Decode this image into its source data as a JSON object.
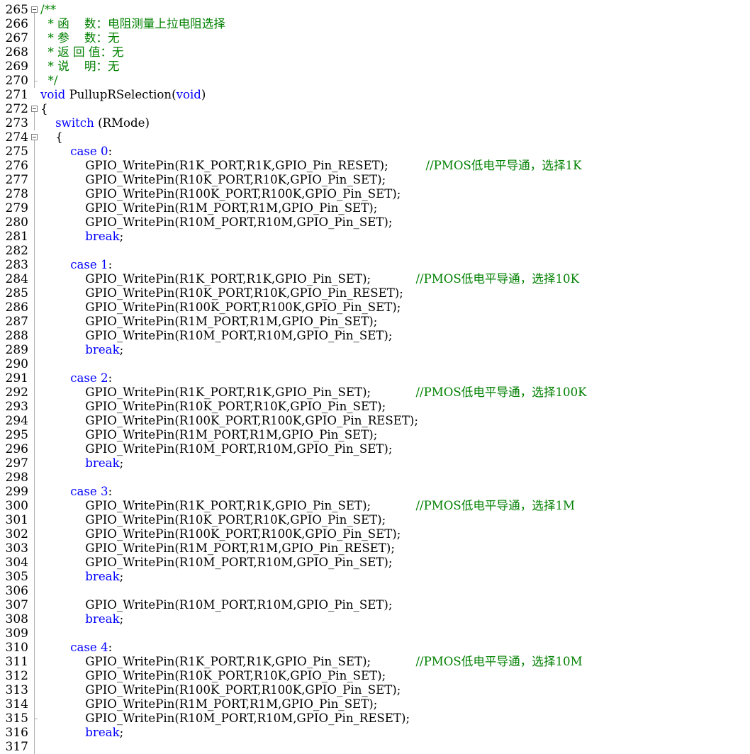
{
  "editor": {
    "colors": {
      "background": "#ffffff",
      "keyword": "#0000ff",
      "comment": "#008000",
      "text": "#000000",
      "line_number": "#000000",
      "fold_marker": "#808080"
    },
    "lines": [
      {
        "num": "265",
        "fold": "minus",
        "tokens": [
          {
            "t": "/**",
            "k": "cm"
          }
        ]
      },
      {
        "num": "266",
        "fold": "line",
        "tokens": [
          {
            "t": "  * 函    数：电阻测量上拉电阻选择",
            "k": "cm"
          }
        ]
      },
      {
        "num": "267",
        "fold": "line",
        "tokens": [
          {
            "t": "  * 参    数：无",
            "k": "cm"
          }
        ]
      },
      {
        "num": "268",
        "fold": "line",
        "tokens": [
          {
            "t": "  * 返 回 值：无",
            "k": "cm"
          }
        ]
      },
      {
        "num": "269",
        "fold": "line",
        "tokens": [
          {
            "t": "  * 说    明：无",
            "k": "cm"
          }
        ]
      },
      {
        "num": "270",
        "fold": "end",
        "tokens": [
          {
            "t": "  */",
            "k": "cm"
          }
        ]
      },
      {
        "num": "271",
        "fold": "",
        "tokens": [
          {
            "t": "void",
            "k": "kw"
          },
          {
            "t": " PullupRSelection(",
            "k": "tx"
          },
          {
            "t": "void",
            "k": "kw"
          },
          {
            "t": ")",
            "k": "tx"
          }
        ]
      },
      {
        "num": "272",
        "fold": "minus",
        "tokens": [
          {
            "t": "{",
            "k": "tx"
          }
        ]
      },
      {
        "num": "273",
        "fold": "line",
        "tokens": [
          {
            "t": "    ",
            "k": "tx"
          },
          {
            "t": "switch",
            "k": "kw"
          },
          {
            "t": " (RMode)",
            "k": "tx"
          }
        ]
      },
      {
        "num": "274",
        "fold": "minus",
        "tokens": [
          {
            "t": "    {",
            "k": "tx"
          }
        ]
      },
      {
        "num": "275",
        "fold": "line",
        "tokens": [
          {
            "t": "        ",
            "k": "tx"
          },
          {
            "t": "case",
            "k": "kw"
          },
          {
            "t": " ",
            "k": "tx"
          },
          {
            "t": "0",
            "k": "kw"
          },
          {
            "t": ":",
            "k": "tx"
          }
        ]
      },
      {
        "num": "276",
        "fold": "line",
        "tokens": [
          {
            "t": "            GPIO_WritePin(R1K_PORT,R1K,GPIO_Pin_RESET);          ",
            "k": "tx"
          },
          {
            "t": "//PMOS低电平导通，选择1K",
            "k": "cm"
          }
        ]
      },
      {
        "num": "277",
        "fold": "line",
        "tokens": [
          {
            "t": "            GPIO_WritePin(R10K_PORT,R10K,GPIO_Pin_SET);",
            "k": "tx"
          }
        ]
      },
      {
        "num": "278",
        "fold": "line",
        "tokens": [
          {
            "t": "            GPIO_WritePin(R100K_PORT,R100K,GPIO_Pin_SET);",
            "k": "tx"
          }
        ]
      },
      {
        "num": "279",
        "fold": "line",
        "tokens": [
          {
            "t": "            GPIO_WritePin(R1M_PORT,R1M,GPIO_Pin_SET);",
            "k": "tx"
          }
        ]
      },
      {
        "num": "280",
        "fold": "line",
        "tokens": [
          {
            "t": "            GPIO_WritePin(R10M_PORT,R10M,GPIO_Pin_SET);",
            "k": "tx"
          }
        ]
      },
      {
        "num": "281",
        "fold": "line",
        "tokens": [
          {
            "t": "            ",
            "k": "tx"
          },
          {
            "t": "break",
            "k": "kw"
          },
          {
            "t": ";",
            "k": "tx"
          }
        ]
      },
      {
        "num": "282",
        "fold": "line",
        "tokens": []
      },
      {
        "num": "283",
        "fold": "line",
        "tokens": [
          {
            "t": "        ",
            "k": "tx"
          },
          {
            "t": "case",
            "k": "kw"
          },
          {
            "t": " ",
            "k": "tx"
          },
          {
            "t": "1",
            "k": "kw"
          },
          {
            "t": ":",
            "k": "tx"
          }
        ]
      },
      {
        "num": "284",
        "fold": "line",
        "tokens": [
          {
            "t": "            GPIO_WritePin(R1K_PORT,R1K,GPIO_Pin_SET);            ",
            "k": "tx"
          },
          {
            "t": "//PMOS低电平导通，选择10K",
            "k": "cm"
          }
        ]
      },
      {
        "num": "285",
        "fold": "line",
        "tokens": [
          {
            "t": "            GPIO_WritePin(R10K_PORT,R10K,GPIO_Pin_RESET);",
            "k": "tx"
          }
        ]
      },
      {
        "num": "286",
        "fold": "line",
        "tokens": [
          {
            "t": "            GPIO_WritePin(R100K_PORT,R100K,GPIO_Pin_SET);",
            "k": "tx"
          }
        ]
      },
      {
        "num": "287",
        "fold": "line",
        "tokens": [
          {
            "t": "            GPIO_WritePin(R1M_PORT,R1M,GPIO_Pin_SET);",
            "k": "tx"
          }
        ]
      },
      {
        "num": "288",
        "fold": "line",
        "tokens": [
          {
            "t": "            GPIO_WritePin(R10M_PORT,R10M,GPIO_Pin_SET);",
            "k": "tx"
          }
        ]
      },
      {
        "num": "289",
        "fold": "line",
        "tokens": [
          {
            "t": "            ",
            "k": "tx"
          },
          {
            "t": "break",
            "k": "kw"
          },
          {
            "t": ";",
            "k": "tx"
          }
        ]
      },
      {
        "num": "290",
        "fold": "line",
        "tokens": []
      },
      {
        "num": "291",
        "fold": "line",
        "tokens": [
          {
            "t": "        ",
            "k": "tx"
          },
          {
            "t": "case",
            "k": "kw"
          },
          {
            "t": " ",
            "k": "tx"
          },
          {
            "t": "2",
            "k": "kw"
          },
          {
            "t": ":",
            "k": "tx"
          }
        ]
      },
      {
        "num": "292",
        "fold": "line",
        "tokens": [
          {
            "t": "            GPIO_WritePin(R1K_PORT,R1K,GPIO_Pin_SET);            ",
            "k": "tx"
          },
          {
            "t": "//PMOS低电平导通，选择100K",
            "k": "cm"
          }
        ]
      },
      {
        "num": "293",
        "fold": "line",
        "tokens": [
          {
            "t": "            GPIO_WritePin(R10K_PORT,R10K,GPIO_Pin_SET);",
            "k": "tx"
          }
        ]
      },
      {
        "num": "294",
        "fold": "line",
        "tokens": [
          {
            "t": "            GPIO_WritePin(R100K_PORT,R100K,GPIO_Pin_RESET);",
            "k": "tx"
          }
        ]
      },
      {
        "num": "295",
        "fold": "line",
        "tokens": [
          {
            "t": "            GPIO_WritePin(R1M_PORT,R1M,GPIO_Pin_SET);",
            "k": "tx"
          }
        ]
      },
      {
        "num": "296",
        "fold": "line",
        "tokens": [
          {
            "t": "            GPIO_WritePin(R10M_PORT,R10M,GPIO_Pin_SET);",
            "k": "tx"
          }
        ]
      },
      {
        "num": "297",
        "fold": "line",
        "tokens": [
          {
            "t": "            ",
            "k": "tx"
          },
          {
            "t": "break",
            "k": "kw"
          },
          {
            "t": ";",
            "k": "tx"
          }
        ]
      },
      {
        "num": "298",
        "fold": "line",
        "tokens": []
      },
      {
        "num": "299",
        "fold": "line",
        "tokens": [
          {
            "t": "        ",
            "k": "tx"
          },
          {
            "t": "case",
            "k": "kw"
          },
          {
            "t": " ",
            "k": "tx"
          },
          {
            "t": "3",
            "k": "kw"
          },
          {
            "t": ":",
            "k": "tx"
          }
        ]
      },
      {
        "num": "300",
        "fold": "line",
        "tokens": [
          {
            "t": "            GPIO_WritePin(R1K_PORT,R1K,GPIO_Pin_SET);            ",
            "k": "tx"
          },
          {
            "t": "//PMOS低电平导通，选择1M",
            "k": "cm"
          }
        ]
      },
      {
        "num": "301",
        "fold": "line",
        "tokens": [
          {
            "t": "            GPIO_WritePin(R10K_PORT,R10K,GPIO_Pin_SET);",
            "k": "tx"
          }
        ]
      },
      {
        "num": "302",
        "fold": "line",
        "tokens": [
          {
            "t": "            GPIO_WritePin(R100K_PORT,R100K,GPIO_Pin_SET);",
            "k": "tx"
          }
        ]
      },
      {
        "num": "303",
        "fold": "line",
        "tokens": [
          {
            "t": "            GPIO_WritePin(R1M_PORT,R1M,GPIO_Pin_RESET);",
            "k": "tx"
          }
        ]
      },
      {
        "num": "304",
        "fold": "line",
        "tokens": [
          {
            "t": "            GPIO_WritePin(R10M_PORT,R10M,GPIO_Pin_SET);",
            "k": "tx"
          }
        ]
      },
      {
        "num": "305",
        "fold": "line",
        "tokens": [
          {
            "t": "            ",
            "k": "tx"
          },
          {
            "t": "break",
            "k": "kw"
          },
          {
            "t": ";",
            "k": "tx"
          }
        ]
      },
      {
        "num": "306",
        "fold": "line",
        "tokens": []
      },
      {
        "num": "307",
        "fold": "line",
        "tokens": [
          {
            "t": "            GPIO_WritePin(R10M_PORT,R10M,GPIO_Pin_SET);",
            "k": "tx"
          }
        ]
      },
      {
        "num": "308",
        "fold": "line",
        "tokens": [
          {
            "t": "            ",
            "k": "tx"
          },
          {
            "t": "break",
            "k": "kw"
          },
          {
            "t": ";",
            "k": "tx"
          }
        ]
      },
      {
        "num": "309",
        "fold": "line",
        "tokens": []
      },
      {
        "num": "310",
        "fold": "line",
        "tokens": [
          {
            "t": "        ",
            "k": "tx"
          },
          {
            "t": "case",
            "k": "kw"
          },
          {
            "t": " ",
            "k": "tx"
          },
          {
            "t": "4",
            "k": "kw"
          },
          {
            "t": ":",
            "k": "tx"
          }
        ]
      },
      {
        "num": "311",
        "fold": "line",
        "tokens": [
          {
            "t": "            GPIO_WritePin(R1K_PORT,R1K,GPIO_Pin_SET);            ",
            "k": "tx"
          },
          {
            "t": "//PMOS低电平导通，选择10M",
            "k": "cm"
          }
        ]
      },
      {
        "num": "312",
        "fold": "line",
        "tokens": [
          {
            "t": "            GPIO_WritePin(R10K_PORT,R10K,GPIO_Pin_SET);",
            "k": "tx"
          }
        ]
      },
      {
        "num": "313",
        "fold": "line",
        "tokens": [
          {
            "t": "            GPIO_WritePin(R100K_PORT,R100K,GPIO_Pin_SET);",
            "k": "tx"
          }
        ]
      },
      {
        "num": "314",
        "fold": "line",
        "tokens": [
          {
            "t": "            GPIO_WritePin(R1M_PORT,R1M,GPIO_Pin_SET);",
            "k": "tx"
          }
        ]
      },
      {
        "num": "315",
        "fold": "end",
        "tokens": [
          {
            "t": "            GPIO_WritePin(R10M_PORT,R10M,GPIO_Pin_RESET);",
            "k": "tx"
          }
        ]
      },
      {
        "num": "316",
        "fold": "line",
        "tokens": [
          {
            "t": "            ",
            "k": "tx"
          },
          {
            "t": "break",
            "k": "kw"
          },
          {
            "t": ";",
            "k": "tx"
          }
        ]
      },
      {
        "num": "317",
        "fold": "line",
        "tokens": []
      }
    ]
  }
}
